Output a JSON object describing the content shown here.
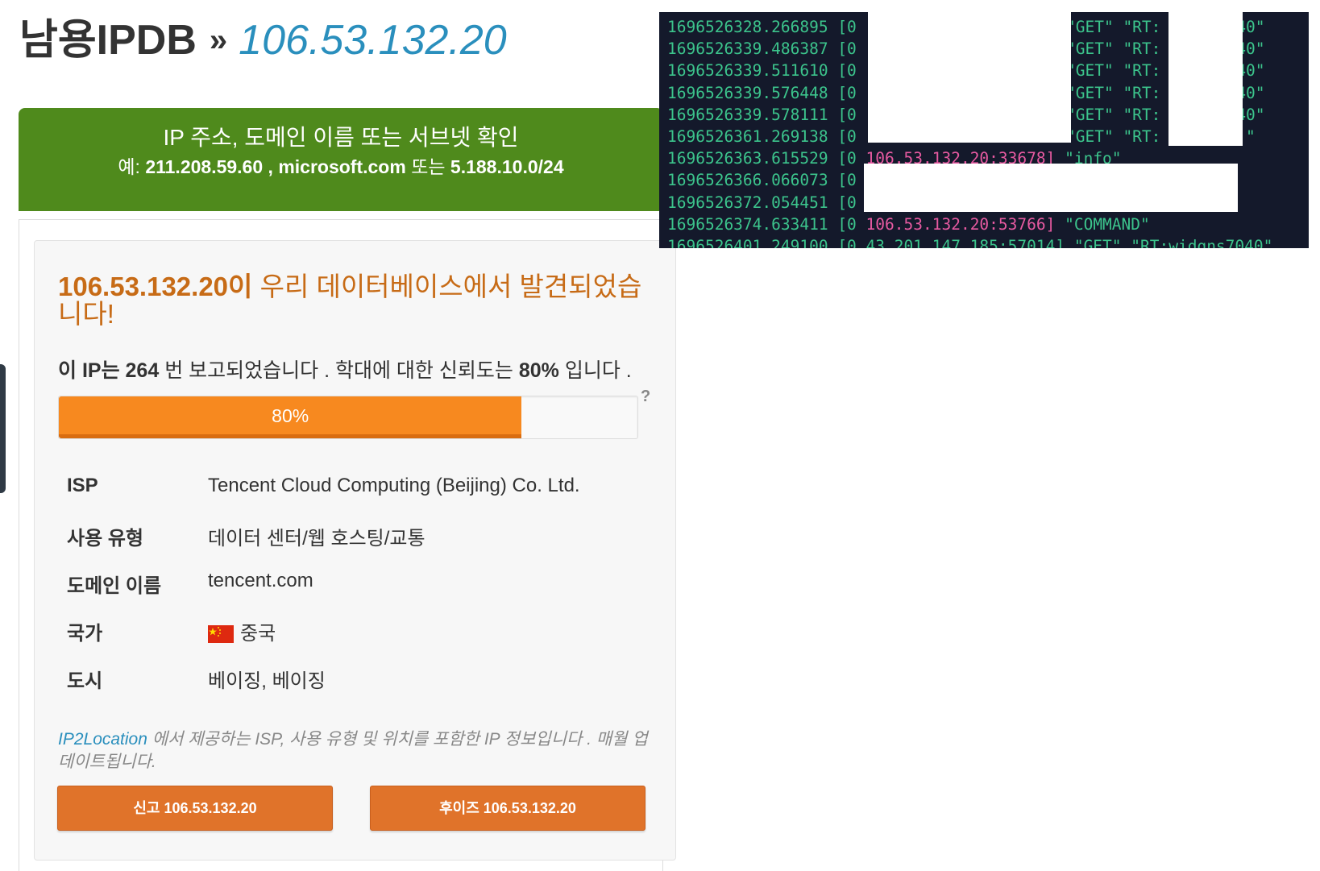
{
  "title": {
    "site": "남용IPDB",
    "separator": "»",
    "ip": "106.53.132.20"
  },
  "search": {
    "heading": "IP 주소, 도메인 이름 또는 서브넷 확인",
    "example_prefix": "예:",
    "example_ip": "211.208.59.60",
    "example_sep1": ",",
    "example_domain": "microsoft.com",
    "example_or": "또는",
    "example_subnet": "5.188.10.0/24"
  },
  "result": {
    "found_ip": "106.53.132.20이",
    "found_text": "우리 데이터베이스에서 발견되었습니다!",
    "report_prefix": "이 IP는",
    "report_count": "264",
    "report_middle": "번 보고되었습니다 . 학대에 대한 신뢰도는",
    "confidence": "80%",
    "report_suffix": "입니다 .",
    "confidence_value": 80,
    "progress_label": "80%",
    "help": "?"
  },
  "details": {
    "rows": [
      {
        "label": "ISP",
        "value": "Tencent Cloud Computing (Beijing) Co. Ltd."
      },
      {
        "label": "사용 유형",
        "value": "데이터 센터/웹 호스팅/교통"
      },
      {
        "label": "도메인 이름",
        "value": "tencent.com"
      },
      {
        "label": "국가",
        "value": "중국",
        "icon": "china-flag-icon"
      },
      {
        "label": "도시",
        "value": "베이징, 베이징"
      }
    ]
  },
  "note": {
    "source": "IP2Location",
    "text": " 에서 제공하는 ISP, 사용 유형 및 위치를 포함한 IP 정보입니다 . 매월 업데이트됩니다."
  },
  "buttons": {
    "report": "신고 106.53.132.20",
    "whois": "후이즈 106.53.132.20"
  },
  "terminal": {
    "lines": [
      {
        "ts": "1696526328.266895 [0",
        "ip": "",
        "msg": "",
        "tail": "\"GET\" \"RT:        40\""
      },
      {
        "ts": "1696526339.486387 [0",
        "ip": "",
        "msg": "",
        "tail": "\"GET\" \"RT:        40\""
      },
      {
        "ts": "1696526339.511610 [0",
        "ip": "",
        "msg": "",
        "tail": "\"GET\" \"RT:        40\""
      },
      {
        "ts": "1696526339.576448 [0",
        "ip": "",
        "msg": "",
        "tail": "\"GET\" \"RT:        40\""
      },
      {
        "ts": "1696526339.578111 [0",
        "ip": "",
        "msg": "",
        "tail": "\"GET\" \"RT:        40\""
      },
      {
        "ts": "1696526361.269138 [0",
        "ip": "",
        "msg": "",
        "tail": "\"GET\" \"RT:         \""
      },
      {
        "ts": "1696526363.615529 [0",
        "ip": " 106.53.132.20:33678]",
        "msg": " \"info\"",
        "tail": ""
      },
      {
        "ts": "1696526366.066073 [0",
        "ip": "",
        "msg": "",
        "tail": ""
      },
      {
        "ts": "1696526372.054451 [0",
        "ip": "",
        "msg": "",
        "tail": ""
      },
      {
        "ts": "1696526374.633411 [0",
        "ip": " 106.53.132.20:53766]",
        "msg": " \"COMMAND\"",
        "tail": ""
      },
      {
        "ts": "1696526401.249100 [0",
        "ip": "",
        "msg": " 43.201.147.185:57014] \"GET\" \"RT:widgns7040\"",
        "tail": ""
      }
    ]
  }
}
